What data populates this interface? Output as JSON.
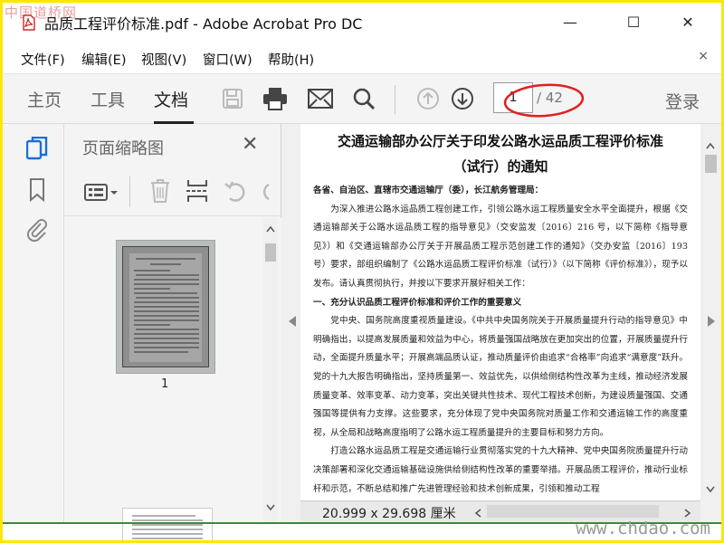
{
  "window": {
    "title": "品质工程评价标准.pdf - Adobe Acrobat Pro DC",
    "watermark_logo": "中国道桥网",
    "minimize": "—",
    "maximize": "☐",
    "close": "✕"
  },
  "menu": {
    "items": [
      "文件(F)",
      "编辑(E)",
      "视图(V)",
      "窗口(W)",
      "帮助(H)"
    ],
    "close": "×"
  },
  "toolbar": {
    "tabs": [
      "主页",
      "工具",
      "文档"
    ],
    "active_tab": "文档",
    "page_current": "1",
    "page_total": "/ 42",
    "login": "登录"
  },
  "thumbnails": {
    "title": "页面缩略图",
    "close": "✕",
    "page1_label": "1"
  },
  "document": {
    "title_line1": "交通运输部办公厅关于印发公路水运品质工程评价标准",
    "title_line2": "（试行）的通知",
    "salutation": "各省、自治区、直辖市交通运输厅（委），长江航务管理局：",
    "para1": "为深入推进公路水运品质工程创建工作，引领公路水运工程质量安全水平全面提升，根据《交通运输部关于公路水运品质工程的指导意见》（交安监发〔2016〕216 号，以下简称《指导意见》）和《交通运输部办公厅关于开展品质工程示范创建工作的通知》（交办安监〔2016〕193 号）要求，部组织编制了《公路水运品质工程评价标准（试行）》（以下简称《评价标准》），现予以发布。请认真贯彻执行，并按以下要求开展好相关工作：",
    "heading1": "一、充分认识品质工程评价标准和评价工作的重要意义",
    "para2": "党中央、国务院高度重视质量建设。《中共中央国务院关于开展质量提升行动的指导意见》中明确指出，以提高发展质量和效益为中心，将质量强国战略放在更加突出的位置，开展质量提升行动，全面提升质量水平；开展高端品质认证，推动质量评价由追求“合格率”向追求“满意度”跃升。党的十九大报告明确指出，坚持质量第一、效益优先，以供给侧结构性改革为主线，推动经济发展质量变革、效率变革、动力变革，突出关键共性技术、现代工程技术创新，为建设质量强国、交通强国等提供有力支撑。这些要求，充分体现了党中央国务院对质量工作和交通运输工作的高度重视，从全局和战略高度指明了公路水运工程质量提升的主要目标和努力方向。",
    "para3": "打造公路水运品质工程是交通运输行业贯彻落实党的十九大精神、党中央国务院质量提升行动决策部署和深化交通运输基础设施供给侧结构性改革的重要举措。开展品质工程评价，推动行业标杆和示范，不断总结和推广先进管理经验和技术创新成果，引领和推动工程"
  },
  "status": {
    "page_size": "20.999 x 29.698 厘米",
    "site_watermark": "www.chdao.com"
  },
  "colors": {
    "accent_blue": "#1a6fd6",
    "annotation_red": "#e02020",
    "frame_yellow": "#ffe600"
  }
}
